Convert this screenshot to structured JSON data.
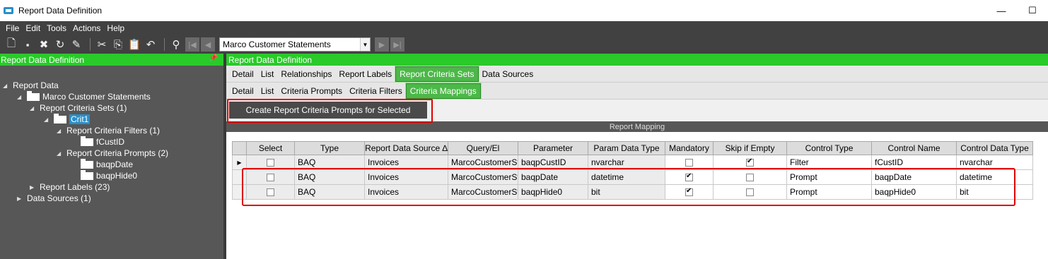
{
  "window": {
    "title": "Report Data Definition",
    "minimize": "—",
    "maximize": "☐"
  },
  "menu": [
    "File",
    "Edit",
    "Tools",
    "Actions",
    "Help"
  ],
  "toolbar": {
    "selector_value": "Marco Customer Statements"
  },
  "left_panel": {
    "header": "Report Data Definition",
    "tree": [
      {
        "label": "Report Data",
        "level": 0,
        "expanded": true,
        "folder": false
      },
      {
        "label": "Marco Customer Statements",
        "level": 1,
        "expanded": true,
        "folder": true
      },
      {
        "label": "Report Criteria Sets (1)",
        "level": 2,
        "expanded": true,
        "folder": false
      },
      {
        "label": "Crit1",
        "level": 3,
        "expanded": true,
        "folder": true,
        "selected": true
      },
      {
        "label": "Report Criteria Filters (1)",
        "level": 4,
        "expanded": true,
        "folder": false
      },
      {
        "label": "fCustID",
        "level": 5,
        "folder": true
      },
      {
        "label": "Report Criteria Prompts (2)",
        "level": 4,
        "expanded": true,
        "folder": false
      },
      {
        "label": "baqpDate",
        "level": 5,
        "folder": true
      },
      {
        "label": "baqpHide0",
        "level": 5,
        "folder": true
      },
      {
        "label": "Report Labels (23)",
        "level": 2,
        "expanded": false,
        "folder": false
      },
      {
        "label": "Data Sources (1)",
        "level": 1,
        "expanded": false,
        "folder": false
      }
    ]
  },
  "main": {
    "header": "Report Data Definition",
    "tabs": [
      {
        "label": "Detail",
        "active": false
      },
      {
        "label": "List",
        "active": false
      },
      {
        "label": "Relationships",
        "active": false
      },
      {
        "label": "Report Labels",
        "active": false
      },
      {
        "label": "Report Criteria Sets",
        "active": true
      },
      {
        "label": "Data Sources",
        "active": false
      }
    ],
    "subtabs": [
      {
        "label": "Detail",
        "active": false
      },
      {
        "label": "List",
        "active": false
      },
      {
        "label": "Criteria Prompts",
        "active": false
      },
      {
        "label": "Criteria Filters",
        "active": false
      },
      {
        "label": "Criteria Mappings",
        "active": true
      }
    ],
    "create_button": "Create Report Criteria Prompts for Selected",
    "grid_title": "Report Mapping",
    "columns": [
      "Select",
      "Type",
      "Report Data Source ∆",
      "Query/El",
      "Parameter",
      "Param Data Type",
      "Mandatory",
      "Skip if Empty",
      "Control Type",
      "Control Name",
      "Control Data Type"
    ],
    "rows": [
      {
        "current": true,
        "select": false,
        "type": "BAQ",
        "source": "Invoices",
        "query": "MarcoCustomerSt",
        "parameter": "baqpCustID",
        "param_type": "nvarchar",
        "mandatory": false,
        "skip": true,
        "control_type": "Filter",
        "control_name": "fCustID",
        "control_data_type": "nvarchar"
      },
      {
        "current": false,
        "select": false,
        "type": "BAQ",
        "source": "Invoices",
        "query": "MarcoCustomerSt",
        "parameter": "baqpDate",
        "param_type": "datetime",
        "mandatory": true,
        "skip": false,
        "control_type": "Prompt",
        "control_name": "baqpDate",
        "control_data_type": "datetime"
      },
      {
        "current": false,
        "select": false,
        "type": "BAQ",
        "source": "Invoices",
        "query": "MarcoCustomerSt",
        "parameter": "baqpHide0",
        "param_type": "bit",
        "mandatory": true,
        "skip": false,
        "control_type": "Prompt",
        "control_name": "baqpHide0",
        "control_data_type": "bit"
      }
    ]
  }
}
